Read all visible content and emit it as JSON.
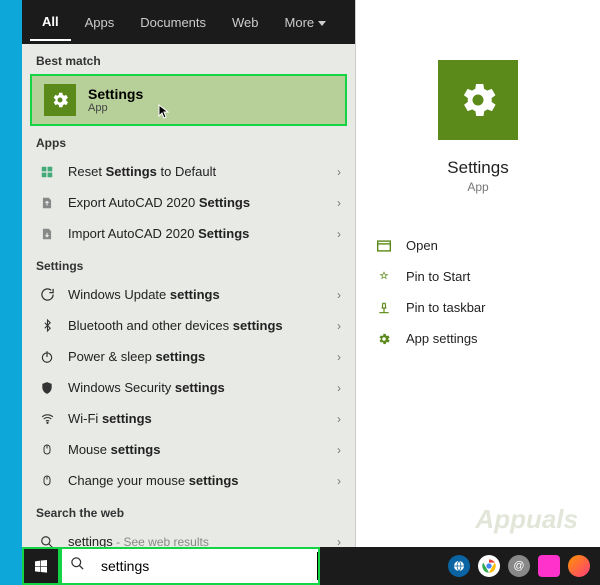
{
  "tabs": {
    "all": "All",
    "apps": "Apps",
    "documents": "Documents",
    "web": "Web",
    "more": "More"
  },
  "sections": {
    "best_match": "Best match",
    "apps": "Apps",
    "settings": "Settings",
    "web": "Search the web"
  },
  "best_match": {
    "title": "Settings",
    "subtitle": "App"
  },
  "apps_list": [
    {
      "pre": "Reset ",
      "bold": "Settings",
      "post": " to Default"
    },
    {
      "pre": "Export AutoCAD 2020 ",
      "bold": "Settings",
      "post": ""
    },
    {
      "pre": "Import AutoCAD 2020 ",
      "bold": "Settings",
      "post": ""
    }
  ],
  "settings_list": [
    {
      "pre": "Windows Update ",
      "bold": "settings",
      "post": ""
    },
    {
      "pre": "Bluetooth and other devices ",
      "bold": "settings",
      "post": ""
    },
    {
      "pre": "Power & sleep ",
      "bold": "settings",
      "post": ""
    },
    {
      "pre": "Windows Security ",
      "bold": "settings",
      "post": ""
    },
    {
      "pre": "Wi-Fi ",
      "bold": "settings",
      "post": ""
    },
    {
      "pre": "Mouse ",
      "bold": "settings",
      "post": ""
    },
    {
      "pre": "Change your mouse ",
      "bold": "settings",
      "post": ""
    }
  ],
  "web_item": {
    "text": "settings",
    "suffix": " - See web results"
  },
  "preview": {
    "title": "Settings",
    "subtitle": "App",
    "actions": {
      "open": "Open",
      "pin_start": "Pin to Start",
      "pin_taskbar": "Pin to taskbar",
      "app_settings": "App settings"
    }
  },
  "search": {
    "value": "settings"
  },
  "watermark": "Appuals"
}
